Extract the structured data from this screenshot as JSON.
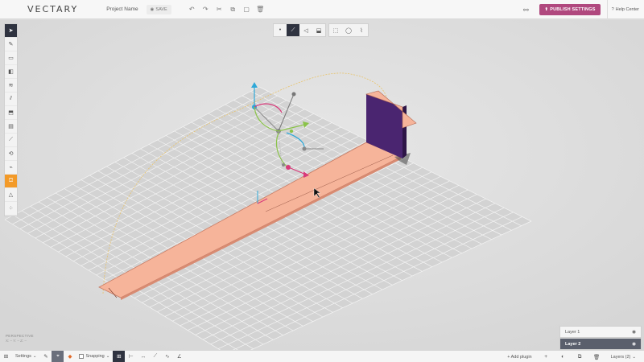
{
  "app": {
    "logo": "VECTARY",
    "project_name": "Project Name",
    "save_label": "SAVE",
    "publish_label": "PUBLISH SETTINGS",
    "help_label": "Help Center"
  },
  "viewport": {
    "camera_label": "PERSPECTIVE",
    "coords": "X: –  Y: –  Z: –"
  },
  "layers": [
    {
      "name": "Layer 1",
      "active": false
    },
    {
      "name": "Layer 2",
      "active": true
    }
  ],
  "bottombar": {
    "settings_label": "Settings",
    "snapping_label": "Snapping",
    "add_plugin_label": "+ Add plugin",
    "layers_label": "Layers (2)"
  },
  "icons": {
    "left_tools": [
      "select-arrow-icon",
      "pen-icon",
      "box-icon",
      "cube-icon",
      "stack-icon",
      "edge-icon",
      "extrude-icon",
      "frame-icon",
      "line-icon",
      "loop-icon",
      "brush-icon",
      "paint-bucket-icon",
      "triangle-icon",
      "scatter-icon"
    ],
    "center_tools": [
      "point-icon",
      "edge-tool-icon",
      "face-icon",
      "object-icon",
      "rect-select-icon",
      "lasso-icon",
      "paint-select-icon"
    ]
  },
  "colors": {
    "accent": "#b0487e",
    "plane": "#f6b49a",
    "wall": "#4a2570",
    "tool_active": "#f39a28"
  }
}
